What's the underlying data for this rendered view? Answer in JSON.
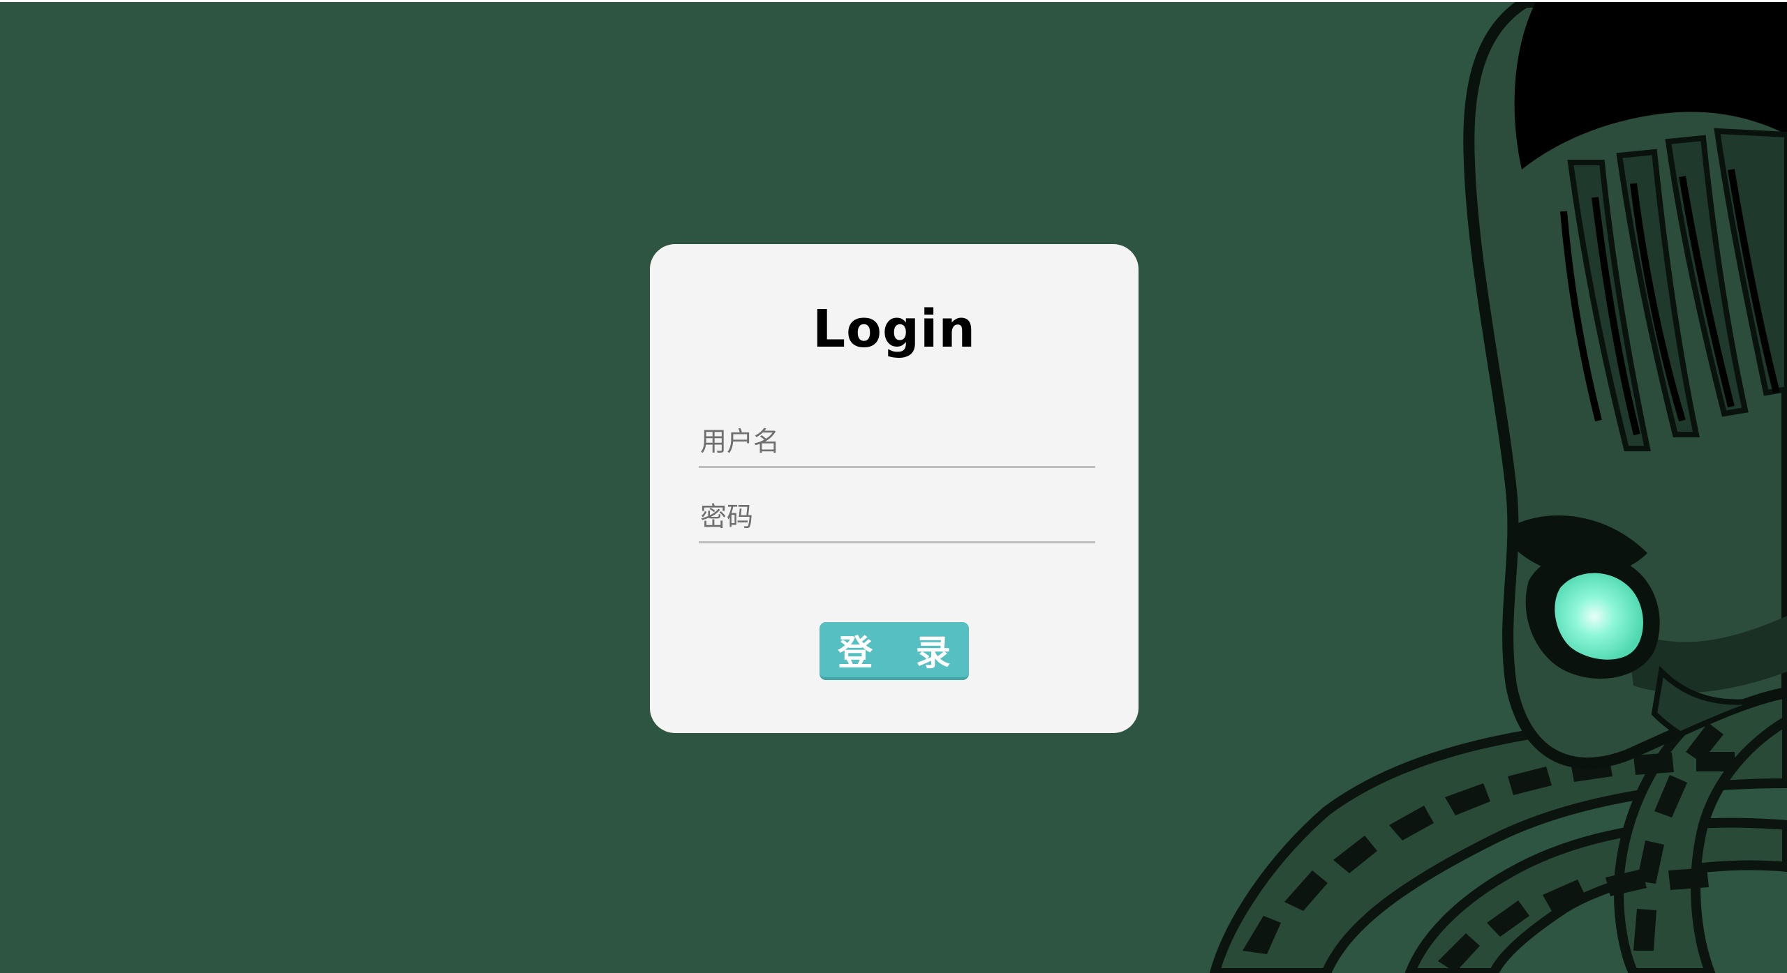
{
  "page": {
    "background_color": "#2e5541"
  },
  "login_card": {
    "title": "Login",
    "username": {
      "placeholder": "用户名",
      "value": ""
    },
    "password": {
      "placeholder": "密码",
      "value": ""
    },
    "submit_label": "登 录",
    "button_color": "#56bfc1"
  },
  "decoration": {
    "illustration": "cthulhu-octopus-illustration",
    "eye_glow_color": "#7ff5d8"
  }
}
